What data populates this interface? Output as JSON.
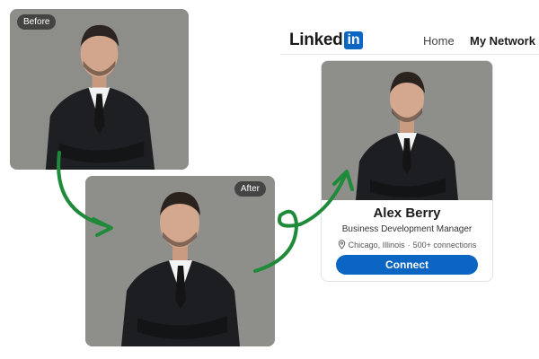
{
  "before_card": {
    "label": "Before"
  },
  "after_card": {
    "label": "After"
  },
  "linkedin": {
    "logo_word": "Linked",
    "logo_box": "in",
    "nav": [
      "Home",
      "My Network"
    ]
  },
  "profile": {
    "name": "Alex Berry",
    "title": "Business Development Manager",
    "location": "Chicago, Illinois",
    "separator": "·",
    "connections": "500+ connections",
    "connect_label": "Connect"
  },
  "colors": {
    "linkedin_blue": "#0a66c2",
    "arrow_green": "#1f8a3a",
    "photo_background": "#8f8f8c"
  },
  "icons": [
    "location-pin-icon",
    "curved-arrow-icon"
  ]
}
